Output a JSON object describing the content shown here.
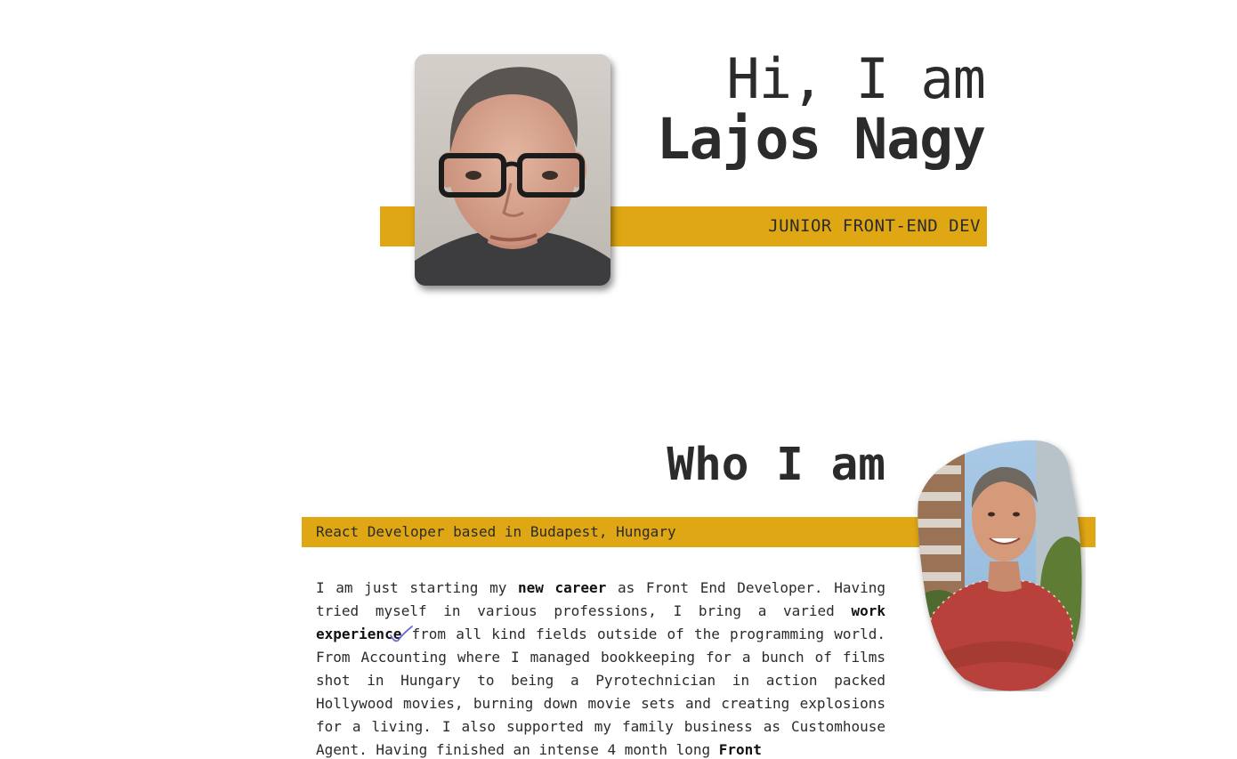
{
  "hero": {
    "greeting": "Hi, I am",
    "name": "Lajos Nagy",
    "role": "JUNIOR FRONT-END DEV",
    "accent_color": "#e0a714"
  },
  "about": {
    "title": "Who I am",
    "subtitle": "React Developer based in Budapest, Hungary",
    "paragraph": {
      "p1": "I am just starting my ",
      "b1": "new career",
      "p2": " as Front End Developer. Having tried myself in various professions, I bring a varied ",
      "b2": "work experience",
      "p3": " from all kind fields outside of the programming world. From Accounting where I managed bookkeeping for a bunch of films shot in Hungary to being a Pyrotechnician in action packed Hollywood movies, burning down movie sets and creating explosions for a living. I also supported my family business as Customhouse Agent. Having finished an intense 4 month long ",
      "b3": "Front"
    }
  },
  "icons": {
    "portrait": "portrait-photo",
    "portrait_outdoor": "portrait-outdoor-photo",
    "check": "check-mark-icon"
  }
}
